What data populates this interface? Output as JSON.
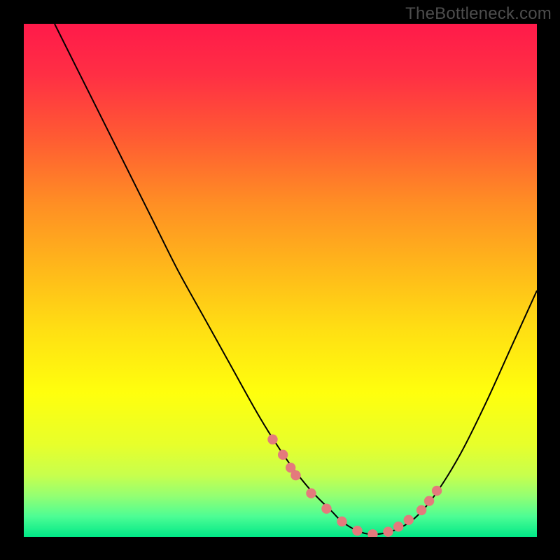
{
  "watermark": "TheBottleneck.com",
  "colors": {
    "bg": "#000000",
    "curve": "#000000",
    "dot_fill": "#e47a7c",
    "dot_stroke": "#e47a7c",
    "gradient_stops": [
      {
        "offset": 0.0,
        "color": "#ff1a4a"
      },
      {
        "offset": 0.1,
        "color": "#ff2f44"
      },
      {
        "offset": 0.22,
        "color": "#ff5a33"
      },
      {
        "offset": 0.35,
        "color": "#ff8e24"
      },
      {
        "offset": 0.48,
        "color": "#ffb91a"
      },
      {
        "offset": 0.6,
        "color": "#ffe013"
      },
      {
        "offset": 0.72,
        "color": "#ffff0d"
      },
      {
        "offset": 0.82,
        "color": "#e7ff2b"
      },
      {
        "offset": 0.88,
        "color": "#c7ff4d"
      },
      {
        "offset": 0.92,
        "color": "#94ff72"
      },
      {
        "offset": 0.96,
        "color": "#4dfd94"
      },
      {
        "offset": 1.0,
        "color": "#00e887"
      }
    ]
  },
  "chart_data": {
    "type": "line",
    "title": "",
    "xlabel": "",
    "ylabel": "",
    "xlim": [
      0,
      100
    ],
    "ylim": [
      0,
      100
    ],
    "grid": false,
    "legend": false,
    "series": [
      {
        "name": "bottleneck-curve",
        "x": [
          6,
          10,
          15,
          20,
          25,
          30,
          35,
          40,
          45,
          48,
          52,
          56,
          60,
          62,
          65,
          68,
          72,
          76,
          80,
          85,
          90,
          95,
          100
        ],
        "y": [
          100,
          92,
          82,
          72,
          62,
          52,
          43,
          34,
          25,
          20,
          14,
          9,
          5,
          3,
          1.2,
          0.5,
          1.2,
          3.5,
          8,
          16,
          26,
          37,
          48
        ]
      }
    ],
    "markers": {
      "name": "highlight-dots",
      "x": [
        48.5,
        50.5,
        52,
        53,
        56,
        59,
        62,
        65,
        68,
        71,
        73,
        75,
        77.5,
        79,
        80.5
      ],
      "y": [
        19,
        16,
        13.5,
        12,
        8.5,
        5.5,
        3,
        1.2,
        0.5,
        1,
        2,
        3.3,
        5.2,
        7,
        9
      ]
    }
  }
}
